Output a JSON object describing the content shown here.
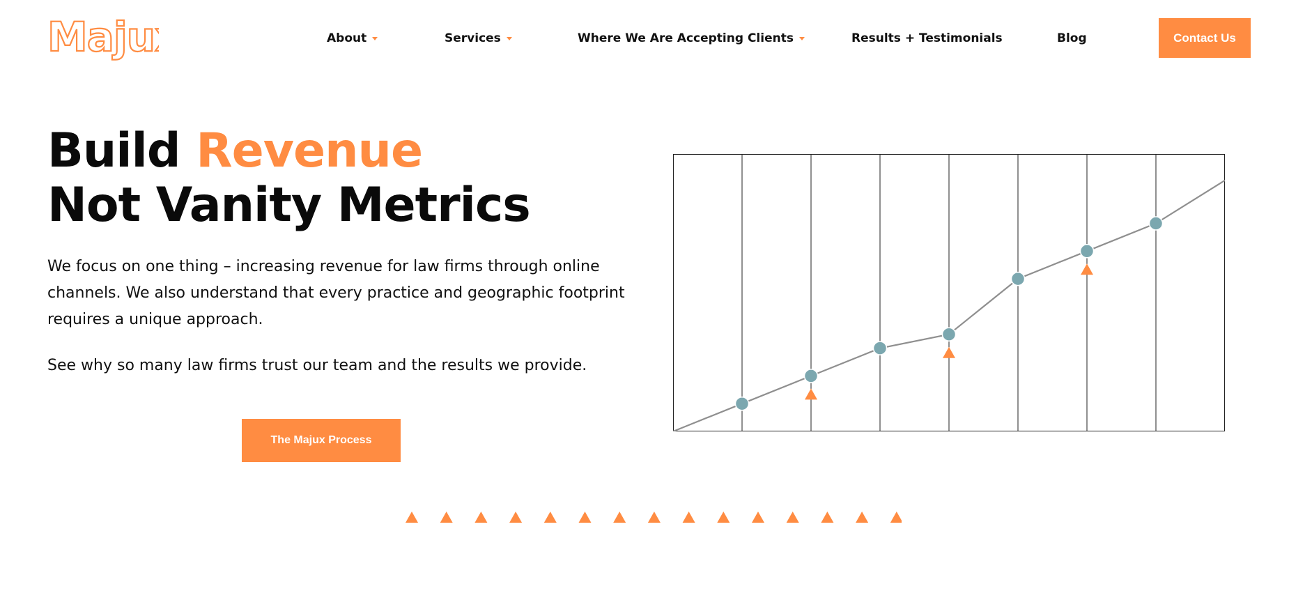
{
  "brand": {
    "name": "Majux",
    "color": "#FF8C42"
  },
  "nav": {
    "items": [
      {
        "label": "About",
        "dropdown": true
      },
      {
        "label": "Services",
        "dropdown": true
      },
      {
        "label": "Where We Are Accepting Clients",
        "dropdown": true
      },
      {
        "label": "Results + Testimonials",
        "dropdown": false
      },
      {
        "label": "Blog",
        "dropdown": false
      }
    ],
    "cta": "Contact Us"
  },
  "hero": {
    "title_part1": "Build ",
    "title_accent": "Revenue",
    "title_line2": "Not Vanity Metrics",
    "description": "We focus on one thing – increasing revenue for law firms through online channels. We also understand that every practice and geographic footprint requires a unique approach.",
    "tagline": "See why so many law firms trust our team and the results we provide.",
    "cta": "The Majux Process"
  },
  "colors": {
    "accent": "#FF8C42",
    "point": "#7BA7AF",
    "line": "#8f8f8f",
    "grid": "#222222"
  },
  "chart_data": {
    "type": "line",
    "series": [
      {
        "values": [
          0,
          1,
          2,
          3,
          3.5,
          5.5,
          6.5,
          7.5,
          9.05
        ]
      }
    ],
    "points_marked": [
      1,
      2,
      3,
      4,
      5,
      6,
      7
    ],
    "triangle_markers_at": [
      2,
      4,
      6
    ],
    "ylim": [
      0,
      10
    ],
    "grid": true
  },
  "decor": {
    "triangle_row_count": 15
  }
}
